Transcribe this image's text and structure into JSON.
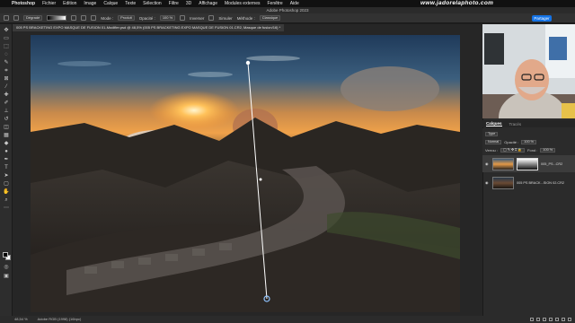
{
  "menubar": {
    "apple_glyph": "",
    "items": [
      "Photoshop",
      "Fichier",
      "Edition",
      "Image",
      "Calque",
      "Texte",
      "Sélection",
      "Filtre",
      "3D",
      "Affichage",
      "Modules externes",
      "Fenêtre",
      "Aide"
    ],
    "site": "www.jadorelaphoto.com"
  },
  "titlebar": {
    "title": "Adobe Photoshop 2023"
  },
  "options": {
    "preset": "Dégradé",
    "mode_label": "Mode :",
    "mode_value": "Produit",
    "opacity_label": "Opacité :",
    "opacity_value": "100 %",
    "reverse_label": "Inverser",
    "simulate_label": "Simuler",
    "method_label": "Méthode :",
    "method_value": "Classique",
    "share_label": "Partager"
  },
  "document": {
    "tab_title": "005 PS BRACKETING EXPO MASQUE DE FUSION 01-Modifier.psd @ 48,5% (005 PS BRACKETING EXPO MASQUE DE FUSION 01.CR2, Masque de fusion/16) *"
  },
  "status": {
    "zoom": "48,54 %",
    "profile": "Adobe RGB (1998) (16bpc)"
  },
  "panels": {
    "tabs": [
      "Calques",
      "Tracés"
    ],
    "active_tab": "Calques",
    "filter_type": "Type",
    "blend_mode": "Normal",
    "opacity_label": "Opacité :",
    "opacity_value": "100 %",
    "lock_label": "Verrou :",
    "fill_label": "Fond :",
    "fill_value": "100 %"
  },
  "layers": [
    {
      "name": "005_PS...CR2",
      "visible": true,
      "has_mask": true,
      "selected": true
    },
    {
      "name": "005 PS BRACK...SION 02.CR2",
      "visible": true,
      "has_mask": false,
      "selected": false
    }
  ],
  "colors": {
    "accent": "#1473e6",
    "foreground": "#000000",
    "background": "#ffffff"
  }
}
